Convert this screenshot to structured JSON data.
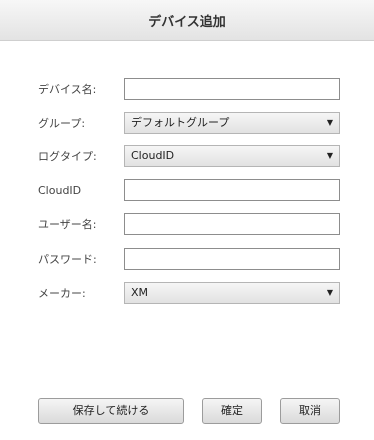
{
  "dialog": {
    "title": "デバイス追加"
  },
  "form": {
    "device_name": {
      "label": "デバイス名:",
      "value": ""
    },
    "group": {
      "label": "グループ:",
      "value": "デフォルトグループ"
    },
    "login_type": {
      "label": "ログタイプ:",
      "value": "CloudID"
    },
    "cloud_id": {
      "label": "CloudID",
      "value": ""
    },
    "username": {
      "label": "ユーザー名:",
      "value": ""
    },
    "password": {
      "label": "パスワード:",
      "value": ""
    },
    "maker": {
      "label": "メーカー:",
      "value": "XM"
    }
  },
  "buttons": {
    "save_continue": "保存して続ける",
    "confirm": "確定",
    "cancel": "取消"
  },
  "icons": {
    "dropdown": "chevron-down-icon"
  }
}
